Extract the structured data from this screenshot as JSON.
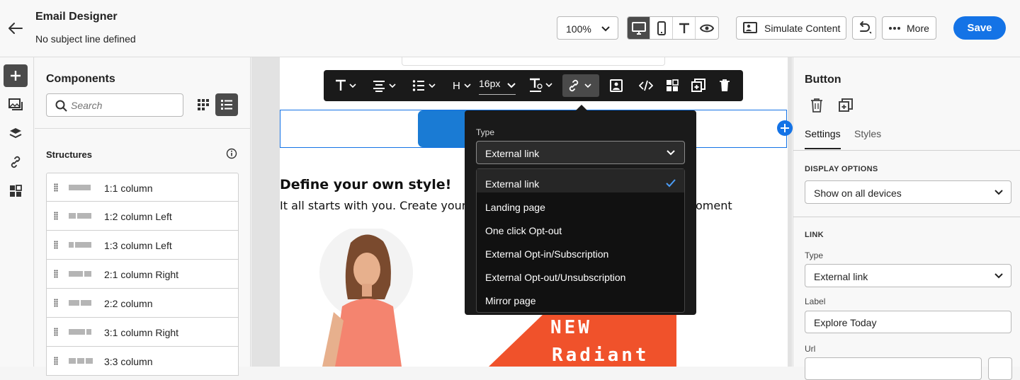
{
  "header": {
    "title": "Email Designer",
    "subject": "No subject line defined",
    "zoom": "100%",
    "simulate_label": "Simulate Content",
    "more_label": "More",
    "save_label": "Save"
  },
  "left_rail": {
    "items": [
      "add-icon",
      "assets-icon",
      "layers-icon",
      "links-icon",
      "fragments-icon"
    ],
    "active": "add-icon"
  },
  "components": {
    "title": "Components",
    "search_placeholder": "Search",
    "structures_title": "Structures",
    "structures": [
      {
        "label": "1:1 column",
        "cols": [
          1
        ]
      },
      {
        "label": "1:2 column Left",
        "cols": [
          1,
          2
        ]
      },
      {
        "label": "1:3 column Left",
        "cols": [
          1,
          3
        ]
      },
      {
        "label": "2:1 column Right",
        "cols": [
          2,
          1
        ]
      },
      {
        "label": "2:2 column",
        "cols": [
          2,
          2
        ]
      },
      {
        "label": "3:1 column Right",
        "cols": [
          3,
          1
        ]
      },
      {
        "label": "3:3 column",
        "cols": [
          1,
          1,
          1
        ]
      }
    ]
  },
  "toolbar": {
    "font_size": "16px",
    "heading_label": "H"
  },
  "canvas": {
    "headline": "Define your own style!",
    "subline_start": "It all starts with you. Create your o",
    "subline_end": "oment",
    "promo_line1": "NEW",
    "promo_line2": "Radiant"
  },
  "link_popover": {
    "type_label": "Type",
    "selected": "External link",
    "options": [
      "External link",
      "Landing page",
      "One click Opt-out",
      "External Opt-in/Subscription",
      "External Opt-out/Unsubscription",
      "Mirror page"
    ]
  },
  "properties": {
    "title": "Button",
    "tabs": [
      "Settings",
      "Styles"
    ],
    "active_tab": "Settings",
    "display_options_label": "DISPLAY OPTIONS",
    "display_value": "Show on all devices",
    "link_section": "LINK",
    "type_label": "Type",
    "type_value": "External link",
    "label_label": "Label",
    "label_value": "Explore Today",
    "url_label": "Url"
  },
  "colors": {
    "accent": "#1473e6",
    "toolbar_bg": "#1a1a1a",
    "cta_blue": "#1a7bd4",
    "promo_orange": "#f0522b"
  }
}
